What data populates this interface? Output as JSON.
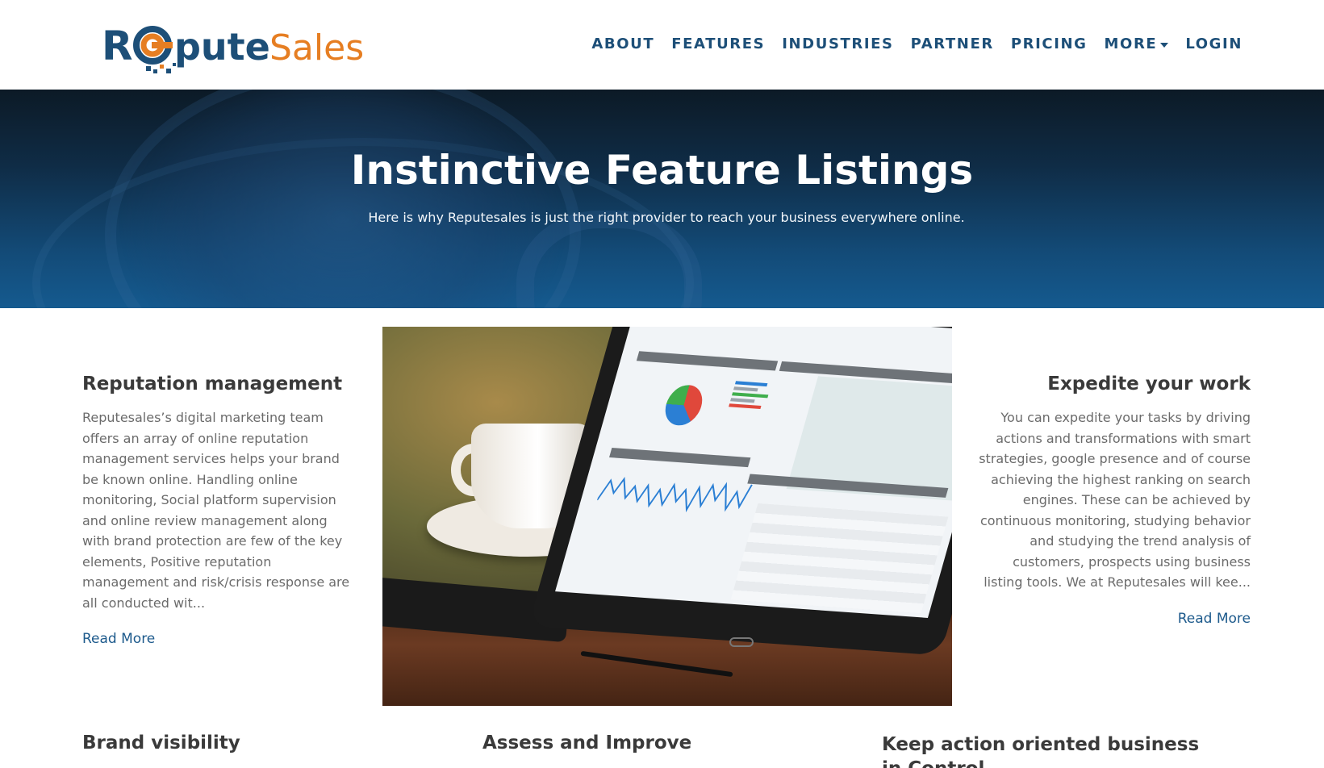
{
  "brand": {
    "logo_text_dark": "R",
    "logo_text_blue": "pute",
    "logo_text_orange": "Sales",
    "color_blue": "#1d4f78",
    "color_orange": "#e67e22"
  },
  "nav": {
    "items": [
      {
        "label": "ABOUT"
      },
      {
        "label": "FEATURES"
      },
      {
        "label": "INDUSTRIES"
      },
      {
        "label": "PARTNER"
      },
      {
        "label": "PRICING"
      },
      {
        "label": "MORE"
      },
      {
        "label": "LOGIN"
      }
    ]
  },
  "hero": {
    "title": "Instinctive Feature Listings",
    "subtitle": "Here is why Reputesales is just the right provider to reach your business everywhere online."
  },
  "features": {
    "left": {
      "title": "Reputation management",
      "text": "Reputesales’s digital marketing team offers an array of online reputation management services helps your brand be known online. Handling online monitoring, Social platform supervision and online review management along with brand protection are few of the key elements, Positive reputation management and risk/crisis response are all conducted wit...",
      "read_more": "Read More"
    },
    "right": {
      "title": "Expedite your work",
      "text": "You can expedite your tasks by driving actions and transformations with smart strategies, google presence and of course achieving the highest ranking on search engines. These can be achieved by continuous monitoring, studying behavior and studying the trend analysis of customers, prospects using business listing tools. We at Reputesales will kee...",
      "read_more": "Read More"
    },
    "bottom": [
      {
        "title": "Brand visibility"
      },
      {
        "title": "Assess and Improve"
      },
      {
        "title": "Keep action oriented business in Control"
      }
    ]
  }
}
